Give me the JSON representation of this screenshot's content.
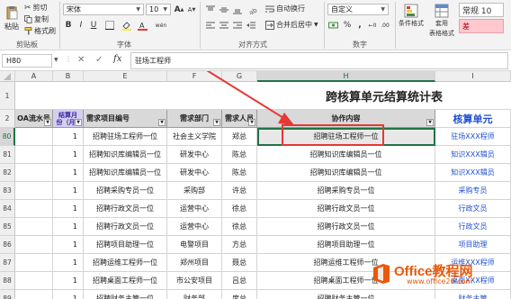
{
  "ribbon": {
    "clipboard": {
      "paste": "粘贴",
      "cut": "剪切",
      "copy": "复制",
      "format_painter": "格式刷",
      "group_label": "剪贴板"
    },
    "font": {
      "name": "宋体",
      "size": "10",
      "bold": "B",
      "italic": "I",
      "underline": "U",
      "grow": "A",
      "shrink": "A",
      "wen": "wén",
      "group_label": "字体"
    },
    "alignment": {
      "wrap_text": "自动换行",
      "merge_center": "合并后居中",
      "group_label": "对齐方式"
    },
    "number": {
      "format": "自定义",
      "percent": "%",
      "comma": ",",
      "group_label": "数字"
    },
    "styles": {
      "conditional": "条件格式",
      "table_format_1": "套用",
      "table_format_2": "表格格式",
      "style_1": "常规 10",
      "style_2": "差"
    }
  },
  "formula_bar": {
    "name_box": "H80",
    "cancel": "✕",
    "enter": "✓",
    "fx": "fx",
    "content": "驻场工程师"
  },
  "grid": {
    "columns": [
      "A",
      "B",
      "E",
      "F",
      "G",
      "H",
      "I"
    ],
    "selected_column": "H",
    "title": "跨核算单元结算统计表",
    "headers": {
      "oa": "OA流水号",
      "month": "结算月份（月）",
      "project": "需求项目编号",
      "dept": "需求部门",
      "person": "需求人员",
      "content": "协作内容",
      "unit": "核算单元"
    },
    "rows": [
      {
        "num": "80",
        "month": "1",
        "project": "招聘驻场工程师一位",
        "dept": "社会主义学院",
        "person": "郑总",
        "content": "招聘驻场工程师一位",
        "unit": "驻场XXX程师"
      },
      {
        "num": "81",
        "month": "1",
        "project": "招聘知识库编辑员一位",
        "dept": "研发中心",
        "person": "陈总",
        "content": "招聘知识库编辑员一位",
        "unit": "知识XXX辑员"
      },
      {
        "num": "82",
        "month": "1",
        "project": "招聘知识库编辑员一位",
        "dept": "研发中心",
        "person": "陈总",
        "content": "招聘知识库编辑员一位",
        "unit": "知识XXX辑员"
      },
      {
        "num": "83",
        "month": "1",
        "project": "招聘采购专员一位",
        "dept": "采购部",
        "person": "许总",
        "content": "招聘采购专员一位",
        "unit": "采购专员"
      },
      {
        "num": "84",
        "month": "1",
        "project": "招聘行政文员一位",
        "dept": "运营中心",
        "person": "徐总",
        "content": "招聘行政文员一位",
        "unit": "行政文员"
      },
      {
        "num": "85",
        "month": "1",
        "project": "招聘行政文员一位",
        "dept": "运营中心",
        "person": "徐总",
        "content": "招聘行政文员一位",
        "unit": "行政文员"
      },
      {
        "num": "86",
        "month": "1",
        "project": "招聘项目助理一位",
        "dept": "电警项目",
        "person": "方总",
        "content": "招聘项目助理一位",
        "unit": "项目助理"
      },
      {
        "num": "87",
        "month": "1",
        "project": "招聘运维工程师一位",
        "dept": "郑州项目",
        "person": "聂总",
        "content": "招聘运维工程师一位",
        "unit": "运维XXX程师"
      },
      {
        "num": "88",
        "month": "1",
        "project": "招聘桌面工程师一位",
        "dept": "市公安项目",
        "person": "吕总",
        "content": "招聘桌面工程师一位",
        "unit": "桌面XXX程师"
      },
      {
        "num": "89",
        "month": "1",
        "project": "招聘财务主管一位",
        "dept": "财务部",
        "person": "席总",
        "content": "招聘财务主管一位",
        "unit": "财务主管"
      }
    ],
    "row_numbers_top": [
      "1",
      "2"
    ]
  },
  "watermark": {
    "brand": "Office教程网",
    "url": "www.office26.com"
  },
  "colors": {
    "highlight_box": "#e53935",
    "arrow": "#e53935",
    "header_fill": "#d9d9d9",
    "unit_header": "#1f4fd1",
    "office_orange": "#e8590c"
  }
}
